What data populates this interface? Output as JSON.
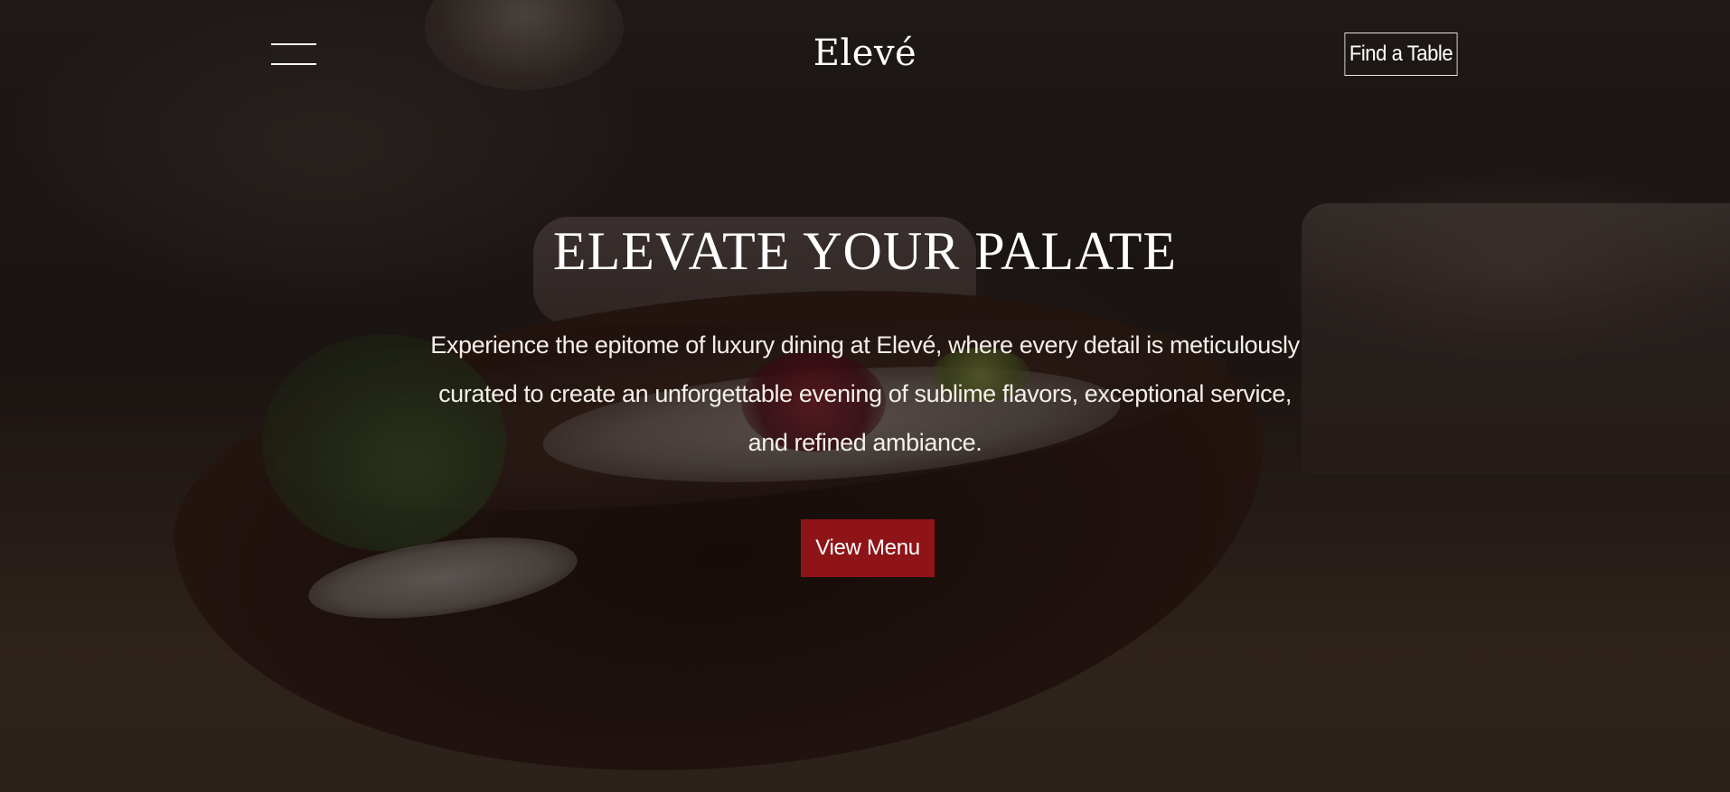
{
  "header": {
    "logo": "Elevé",
    "cta_label": "Find a Table",
    "menu_icon": "hamburger-icon"
  },
  "hero": {
    "title": "ELEVATE YOUR PALATE",
    "description": "Experience the epitome of luxury dining at Elevé, where every detail is meticulously curated to create an unforgettable evening of sublime flavors, exceptional service, and refined ambiance.",
    "button_label": "View Menu"
  },
  "colors": {
    "accent": "#8f1417",
    "text": "#ffffff"
  }
}
